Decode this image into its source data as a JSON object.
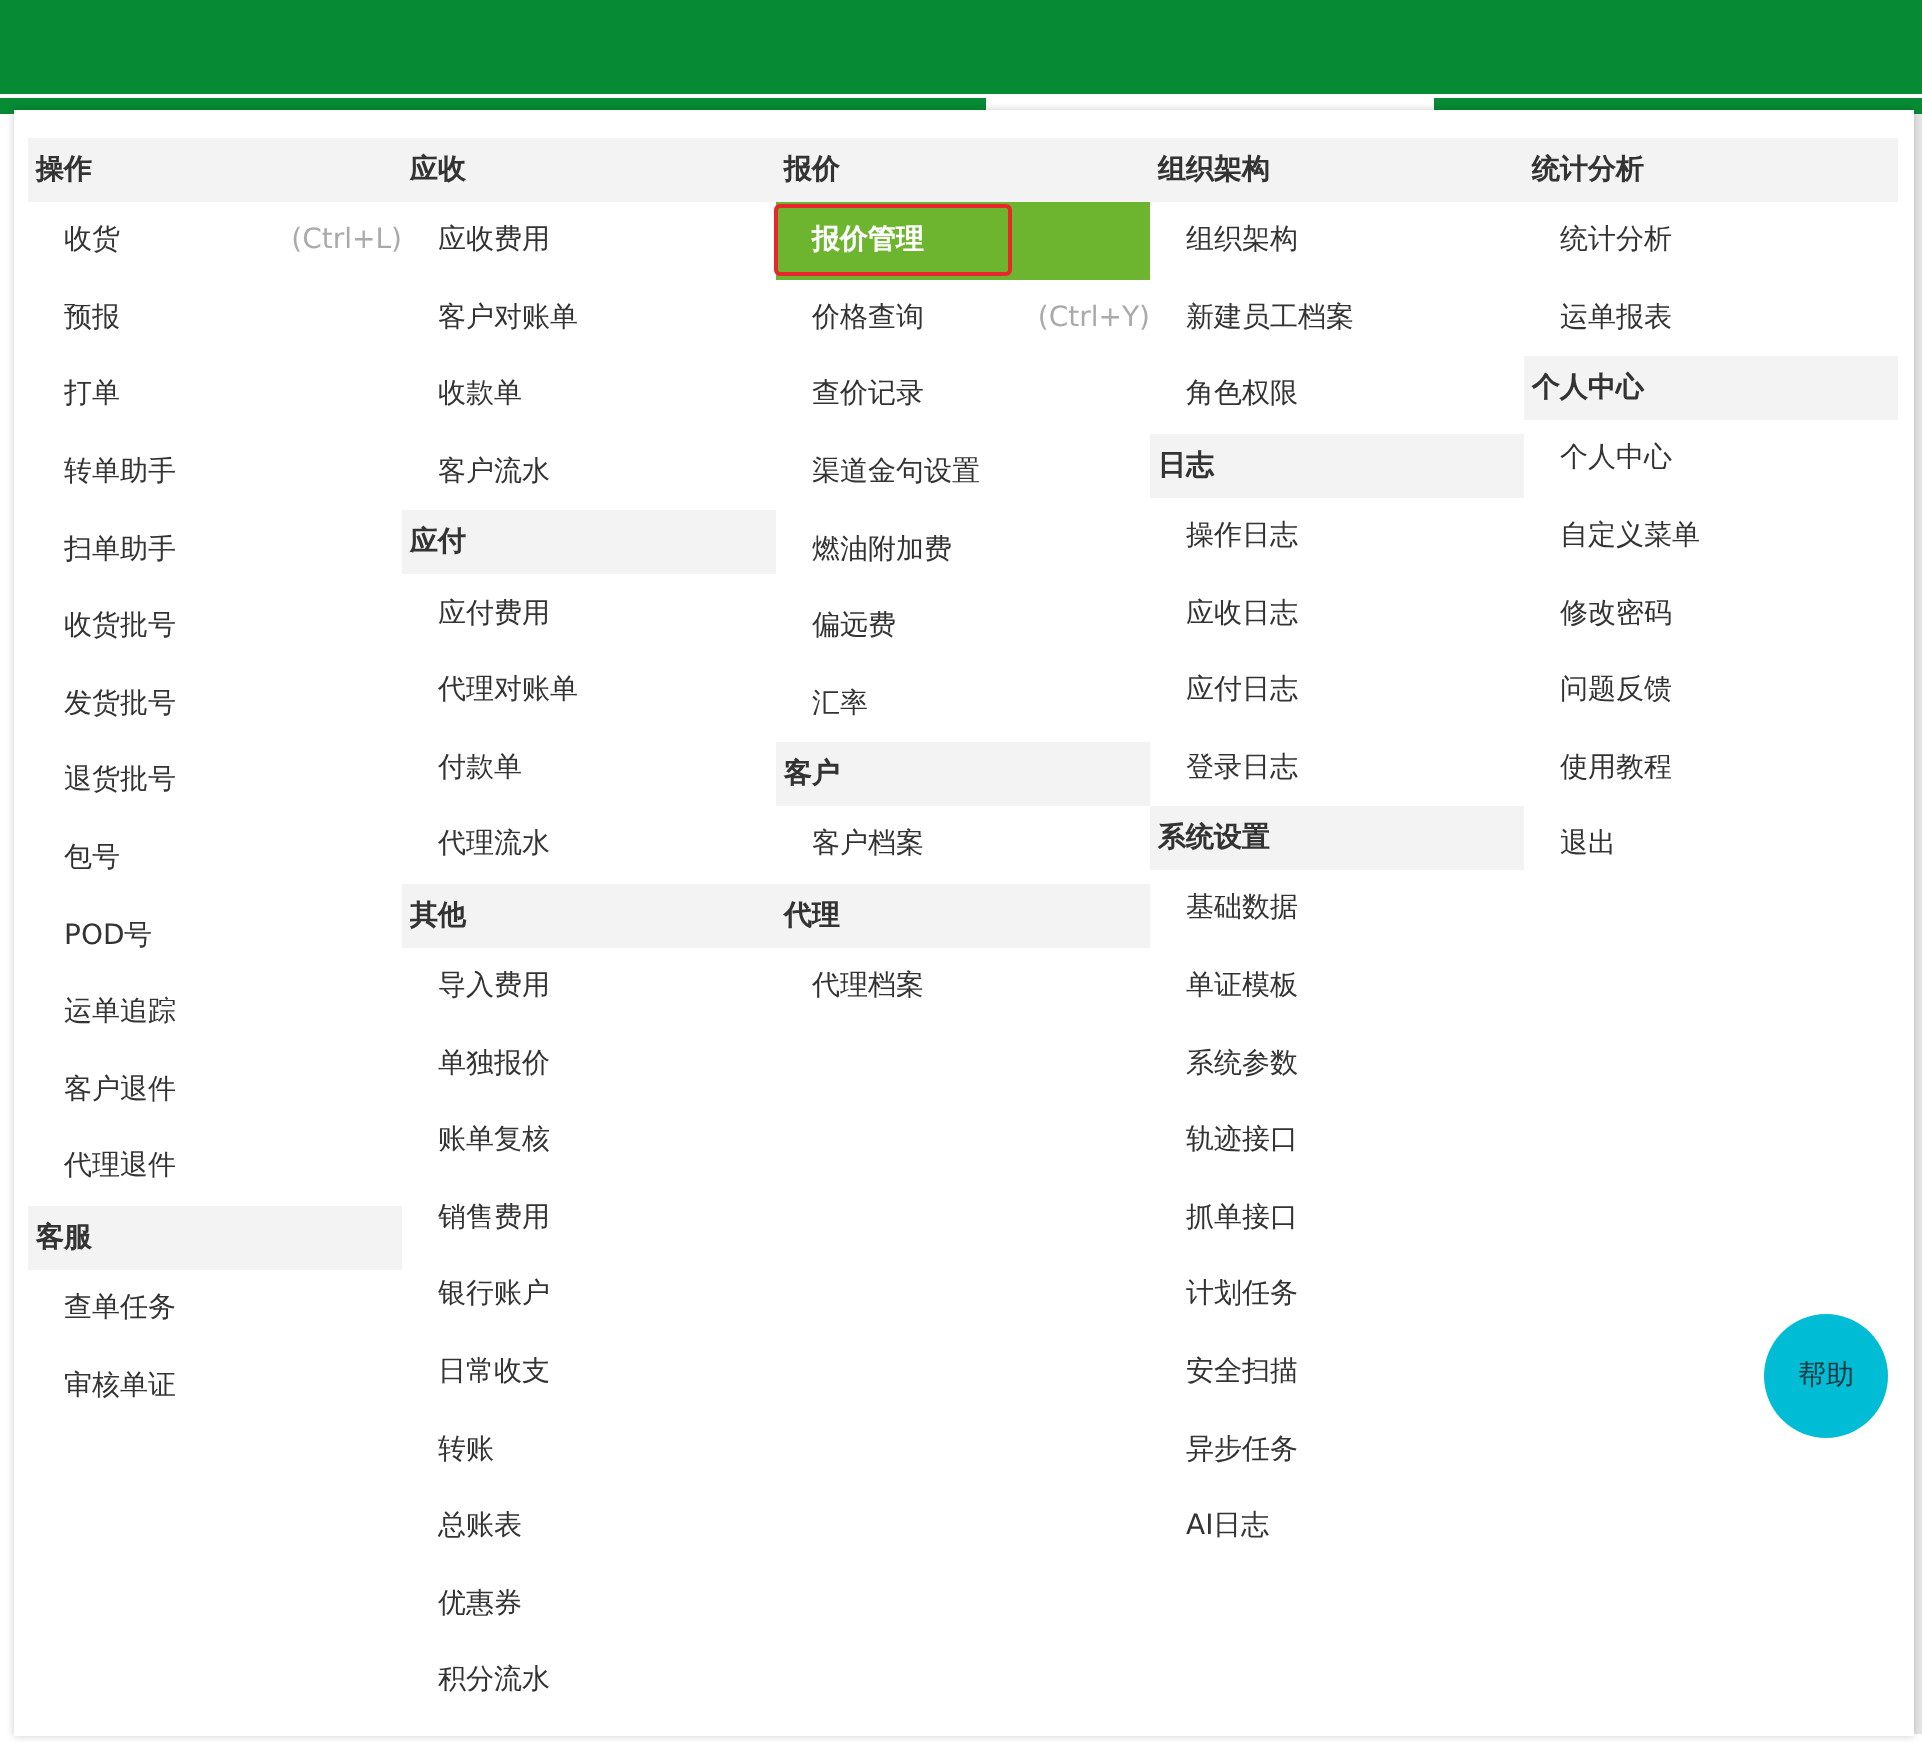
{
  "help_button": "帮助",
  "menu": [
    {
      "sections": [
        {
          "title": "操作",
          "items": [
            {
              "label": "收货",
              "shortcut": "(Ctrl+L)",
              "selected": false
            },
            {
              "label": "预报",
              "selected": false
            },
            {
              "label": "打单",
              "selected": false
            },
            {
              "label": "转单助手",
              "selected": false
            },
            {
              "label": "扫单助手",
              "selected": false
            },
            {
              "label": "收货批号",
              "selected": false
            },
            {
              "label": "发货批号",
              "selected": false
            },
            {
              "label": "退货批号",
              "selected": false
            },
            {
              "label": "包号",
              "selected": false
            },
            {
              "label": "POD号",
              "selected": false
            },
            {
              "label": "运单追踪",
              "selected": false
            },
            {
              "label": "客户退件",
              "selected": false
            },
            {
              "label": "代理退件",
              "selected": false
            }
          ]
        },
        {
          "title": "客服",
          "items": [
            {
              "label": "查单任务",
              "selected": false
            },
            {
              "label": "审核单证",
              "selected": false
            }
          ]
        }
      ]
    },
    {
      "sections": [
        {
          "title": "应收",
          "items": [
            {
              "label": "应收费用",
              "selected": false
            },
            {
              "label": "客户对账单",
              "selected": false
            },
            {
              "label": "收款单",
              "selected": false
            },
            {
              "label": "客户流水",
              "selected": false
            }
          ]
        },
        {
          "title": "应付",
          "items": [
            {
              "label": "应付费用",
              "selected": false
            },
            {
              "label": "代理对账单",
              "selected": false
            },
            {
              "label": "付款单",
              "selected": false
            },
            {
              "label": "代理流水",
              "selected": false
            }
          ]
        },
        {
          "title": "其他",
          "items": [
            {
              "label": "导入费用",
              "selected": false
            },
            {
              "label": "单独报价",
              "selected": false
            },
            {
              "label": "账单复核",
              "selected": false
            },
            {
              "label": "销售费用",
              "selected": false
            },
            {
              "label": "银行账户",
              "selected": false
            },
            {
              "label": "日常收支",
              "selected": false
            },
            {
              "label": "转账",
              "selected": false
            },
            {
              "label": "总账表",
              "selected": false
            },
            {
              "label": "优惠券",
              "selected": false
            },
            {
              "label": "积分流水",
              "selected": false
            }
          ]
        }
      ]
    },
    {
      "sections": [
        {
          "title": "报价",
          "items": [
            {
              "label": "报价管理",
              "selected": true
            },
            {
              "label": "价格查询",
              "shortcut": "(Ctrl+Y)",
              "selected": false
            },
            {
              "label": "查价记录",
              "selected": false
            },
            {
              "label": "渠道金句设置",
              "selected": false
            },
            {
              "label": "燃油附加费",
              "selected": false
            },
            {
              "label": "偏远费",
              "selected": false
            },
            {
              "label": "汇率",
              "selected": false
            }
          ]
        },
        {
          "title": "客户",
          "items": [
            {
              "label": "客户档案",
              "selected": false
            }
          ]
        },
        {
          "title": "代理",
          "items": [
            {
              "label": "代理档案",
              "selected": false
            }
          ]
        }
      ]
    },
    {
      "sections": [
        {
          "title": "组织架构",
          "items": [
            {
              "label": "组织架构",
              "selected": false
            },
            {
              "label": "新建员工档案",
              "selected": false
            },
            {
              "label": "角色权限",
              "selected": false
            }
          ]
        },
        {
          "title": "日志",
          "items": [
            {
              "label": "操作日志",
              "selected": false
            },
            {
              "label": "应收日志",
              "selected": false
            },
            {
              "label": "应付日志",
              "selected": false
            },
            {
              "label": "登录日志",
              "selected": false
            }
          ]
        },
        {
          "title": "系统设置",
          "items": [
            {
              "label": "基础数据",
              "selected": false
            },
            {
              "label": "单证模板",
              "selected": false
            },
            {
              "label": "系统参数",
              "selected": false
            },
            {
              "label": "轨迹接口",
              "selected": false
            },
            {
              "label": "抓单接口",
              "selected": false
            },
            {
              "label": "计划任务",
              "selected": false
            },
            {
              "label": "安全扫描",
              "selected": false
            },
            {
              "label": "异步任务",
              "selected": false
            },
            {
              "label": "AI日志",
              "selected": false
            }
          ]
        }
      ]
    },
    {
      "sections": [
        {
          "title": "统计分析",
          "items": [
            {
              "label": "统计分析",
              "selected": false
            },
            {
              "label": "运单报表",
              "selected": false
            }
          ]
        },
        {
          "title": "个人中心",
          "items": [
            {
              "label": "个人中心",
              "selected": false
            },
            {
              "label": "自定义菜单",
              "selected": false
            },
            {
              "label": "修改密码",
              "selected": false
            },
            {
              "label": "问题反馈",
              "selected": false
            },
            {
              "label": "使用教程",
              "selected": false
            },
            {
              "label": "退出",
              "selected": false
            }
          ]
        }
      ]
    }
  ]
}
